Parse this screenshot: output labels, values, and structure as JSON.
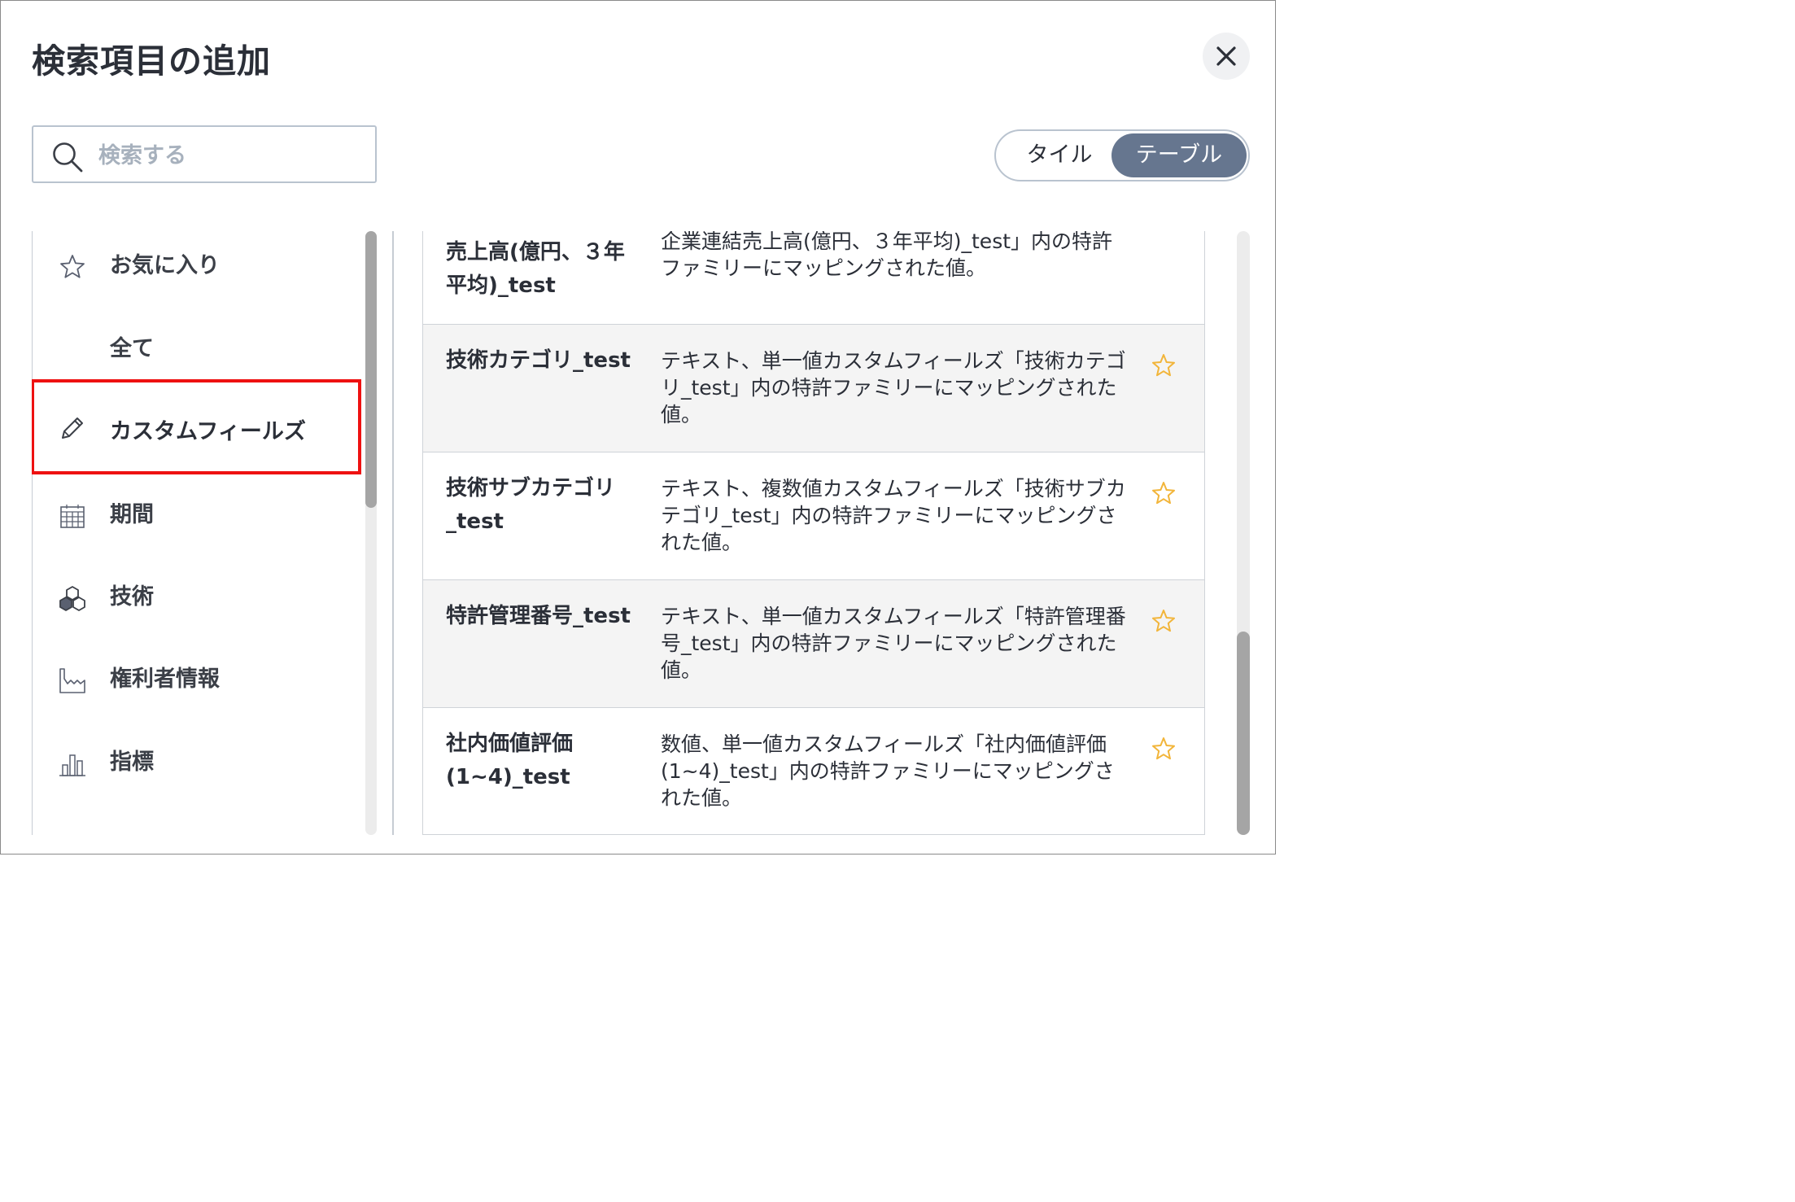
{
  "dialog": {
    "title": "検索項目の追加",
    "close_icon": "close-icon"
  },
  "search": {
    "placeholder": "検索する",
    "value": ""
  },
  "view_toggle": {
    "options": [
      {
        "label": "タイル",
        "selected": false
      },
      {
        "label": "テーブル",
        "selected": true
      }
    ]
  },
  "sidebar": {
    "items": [
      {
        "label": "お気に入り",
        "icon": "star-outline-icon",
        "selected": false
      },
      {
        "label": "全て",
        "icon": "",
        "selected": false
      },
      {
        "label": "カスタムフィールズ",
        "icon": "pencil-icon",
        "selected": true
      },
      {
        "label": "期間",
        "icon": "calendar-icon",
        "selected": false
      },
      {
        "label": "技術",
        "icon": "cubes-icon",
        "selected": false
      },
      {
        "label": "権利者情報",
        "icon": "factory-icon",
        "selected": false
      },
      {
        "label": "指標",
        "icon": "bar-chart-icon",
        "selected": false
      }
    ]
  },
  "fields": [
    {
      "name": "売上高(億円、３年平均)_test",
      "description": "企業連結売上高(億円、３年平均)_test」内の特許ファミリーにマッピングされた値。",
      "favorite_icon": ""
    },
    {
      "name": "技術カテゴリ_test",
      "description": "テキスト、単一値カスタムフィールズ「技術カテゴリ_test」内の特許ファミリーにマッピングされた値。",
      "favorite_icon": "star-outline-icon"
    },
    {
      "name": "技術サブカテゴリ_test",
      "description": "テキスト、複数値カスタムフィールズ「技術サブカテゴリ_test」内の特許ファミリーにマッピングされた値。",
      "favorite_icon": "star-outline-icon"
    },
    {
      "name": "特許管理番号_test",
      "description": "テキスト、単一値カスタムフィールズ「特許管理番号_test」内の特許ファミリーにマッピングされた値。",
      "favorite_icon": "star-outline-icon"
    },
    {
      "name": "社内価値評価(1~4)_test",
      "description": "数値、単一値カスタムフィールズ「社内価値評価(1~4)_test」内の特許ファミリーにマッピングされた値。",
      "favorite_icon": "star-outline-icon"
    }
  ],
  "colors": {
    "selected_toggle": "#66768f",
    "highlight_border": "#ee1111",
    "star": "#f2b53a"
  }
}
